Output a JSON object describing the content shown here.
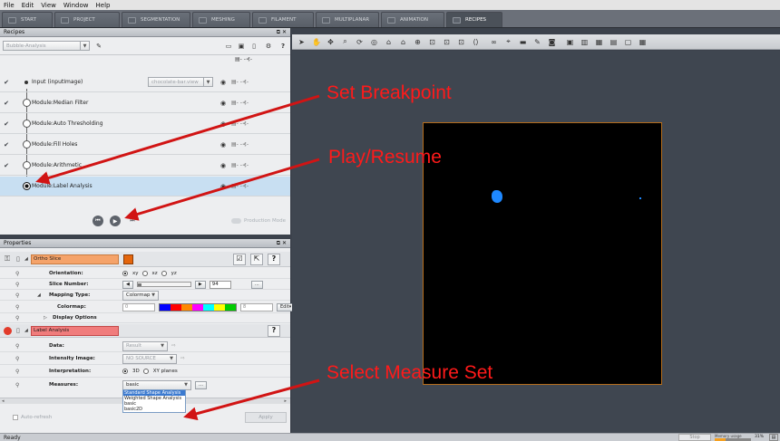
{
  "menu": [
    "File",
    "Edit",
    "View",
    "Window",
    "Help"
  ],
  "tabs": [
    {
      "label": "START",
      "active": false
    },
    {
      "label": "PROJECT",
      "active": false
    },
    {
      "label": "SEGMENTATION",
      "active": false
    },
    {
      "label": "MESHING",
      "active": false
    },
    {
      "label": "FILAMENT",
      "active": false
    },
    {
      "label": "MULTIPLANAR",
      "active": false
    },
    {
      "label": "ANIMATION",
      "active": false
    },
    {
      "label": "RECIPES",
      "active": true
    }
  ],
  "recipes": {
    "title": "Recipes",
    "recipe_select": "Bubble-Analysis",
    "steps": [
      {
        "label": "Input (inputImage)",
        "checked": true,
        "extra": "chocolate-bar.view"
      },
      {
        "label": "Module:Median Filter",
        "checked": true
      },
      {
        "label": "Module:Auto Thresholding",
        "checked": true
      },
      {
        "label": "Module:Fill Holes",
        "checked": true
      },
      {
        "label": "Module:Arithmetic",
        "checked": true
      },
      {
        "label": "Module:Label Analysis",
        "checked": false,
        "selected": true
      }
    ],
    "production_mode": "Production Mode"
  },
  "properties": {
    "title": "Properties",
    "ortho": {
      "name": "Ortho Slice",
      "orientation_label": "Orientation:",
      "orientation_options": [
        "xy",
        "xz",
        "yz"
      ],
      "slice_label": "Slice Number:",
      "slice_value": "94",
      "mapping_label": "Mapping Type:",
      "mapping_value": "Colormap",
      "colormap_label": "Colormap:",
      "colormap_min": "0",
      "colormap_max": "8",
      "edit_label": "Edit",
      "display_options": "Display Options"
    },
    "label_analysis": {
      "name": "Label Analysis",
      "data_label": "Data:",
      "data_value": "Result",
      "intensity_label": "Intensity Image:",
      "intensity_value": "NO SOURCE",
      "interp_label": "Interpretation:",
      "interp_options": [
        "3D",
        "XY planes"
      ],
      "measures_label": "Measures:",
      "measures_value": "basic",
      "dropdown_options": [
        "Standard Shape Analysis",
        "Weighted Shape Analysis",
        "basic",
        "basic2D"
      ]
    },
    "auto_refresh": "Auto-refresh",
    "apply": "Apply"
  },
  "status": {
    "text": "Ready",
    "stop": "Stop",
    "memory_label": "Memory usage",
    "memory_pct": "31%"
  },
  "annotations": {
    "breakpoint": "Set Breakpoint",
    "play": "Play/Resume",
    "measure": "Select Measure Set"
  },
  "colors": {
    "annotation": "#ff1a1a",
    "accent": "#f5a36a",
    "module_red": "#f07c7c",
    "viewer_bg": "#3f4650",
    "slice_border": "#b56d1c",
    "blob": "#1e88ff"
  }
}
